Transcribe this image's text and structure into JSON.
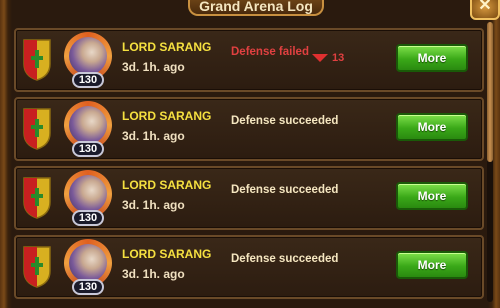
{
  "window": {
    "title": "Grand Arena Log",
    "close_label": "✕"
  },
  "entries": [
    {
      "name": "LORD SARANG",
      "time": "3d. 1h. ago",
      "level": "130",
      "result": "Defense failed",
      "result_status": "failed",
      "rank_change": "13",
      "more_label": "More"
    },
    {
      "name": "LORD SARANG",
      "time": "3d. 1h. ago",
      "level": "130",
      "result": "Defense succeeded",
      "result_status": "succeeded",
      "more_label": "More"
    },
    {
      "name": "LORD SARANG",
      "time": "3d. 1h. ago",
      "level": "130",
      "result": "Defense succeeded",
      "result_status": "succeeded",
      "more_label": "More"
    },
    {
      "name": "LORD SARANG",
      "time": "3d. 1h. ago",
      "level": "130",
      "result": "Defense succeeded",
      "result_status": "succeeded",
      "more_label": "More"
    }
  ],
  "colors": {
    "name": "#f5e040",
    "failed": "#e04040",
    "succeeded": "#f5e6c0",
    "button": "#3aa818"
  },
  "icons": {
    "shield": "clan-shield-icon",
    "rank_down": "rank-down-arrow-icon"
  }
}
